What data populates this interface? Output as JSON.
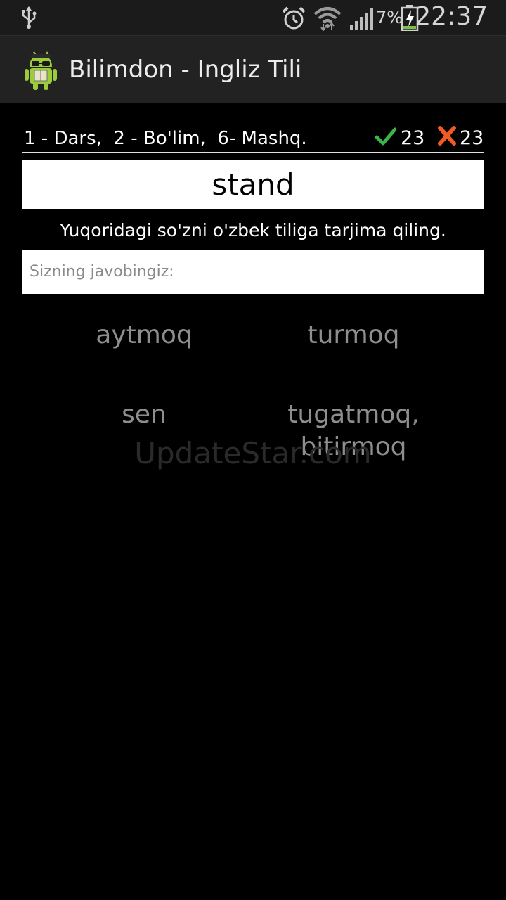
{
  "status_bar": {
    "icons": [
      "usb-icon",
      "alarm-icon",
      "wifi-icon",
      "signal-icon",
      "battery-charging-icon"
    ],
    "battery_percent": "7%",
    "time": "22:37"
  },
  "app_bar": {
    "icon": "android-app-icon",
    "title": "Bilimdon - Ingliz Tili"
  },
  "exercise": {
    "lesson_path": "1 - Dars,  2 - Bo'lim,  6- Mashq.",
    "correct_count": "23",
    "wrong_count": "23",
    "word": "stand",
    "instruction": "Yuqoridagi so'zni o'zbek tiliga tarjima qiling.",
    "answer_placeholder": "Sizning javobingiz:",
    "answer_value": "",
    "options": [
      "aytmoq",
      "turmoq",
      "sen",
      "tugatmoq, bitirmoq"
    ]
  },
  "watermark": "UpdateStar.com",
  "colors": {
    "status_bar_bg": "#1b1b1b",
    "action_bar_bg": "#222222",
    "background": "#000000",
    "correct_green": "#3ab54a",
    "wrong_orange": "#f05a24",
    "option_text": "#8e8e8e"
  }
}
